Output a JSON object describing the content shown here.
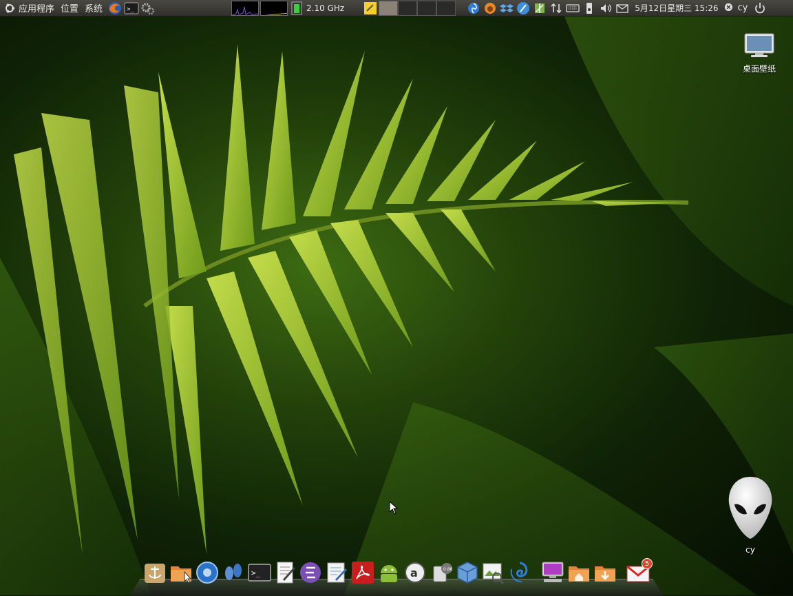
{
  "panel": {
    "menus": [
      "应用程序",
      "位置",
      "系统"
    ],
    "cpu_freq": "2.10 GHz",
    "clock": "5月12日星期三 15:26",
    "user": "cy"
  },
  "desktop": {
    "wallpaper_icon_label": "桌面壁纸",
    "home_icon_label": "cy"
  },
  "dock": {
    "badge_count": "5"
  },
  "colors": {
    "panel_bg": "#3a3935",
    "fern_light": "#b6d33a",
    "fern_dark": "#4f7f12"
  }
}
